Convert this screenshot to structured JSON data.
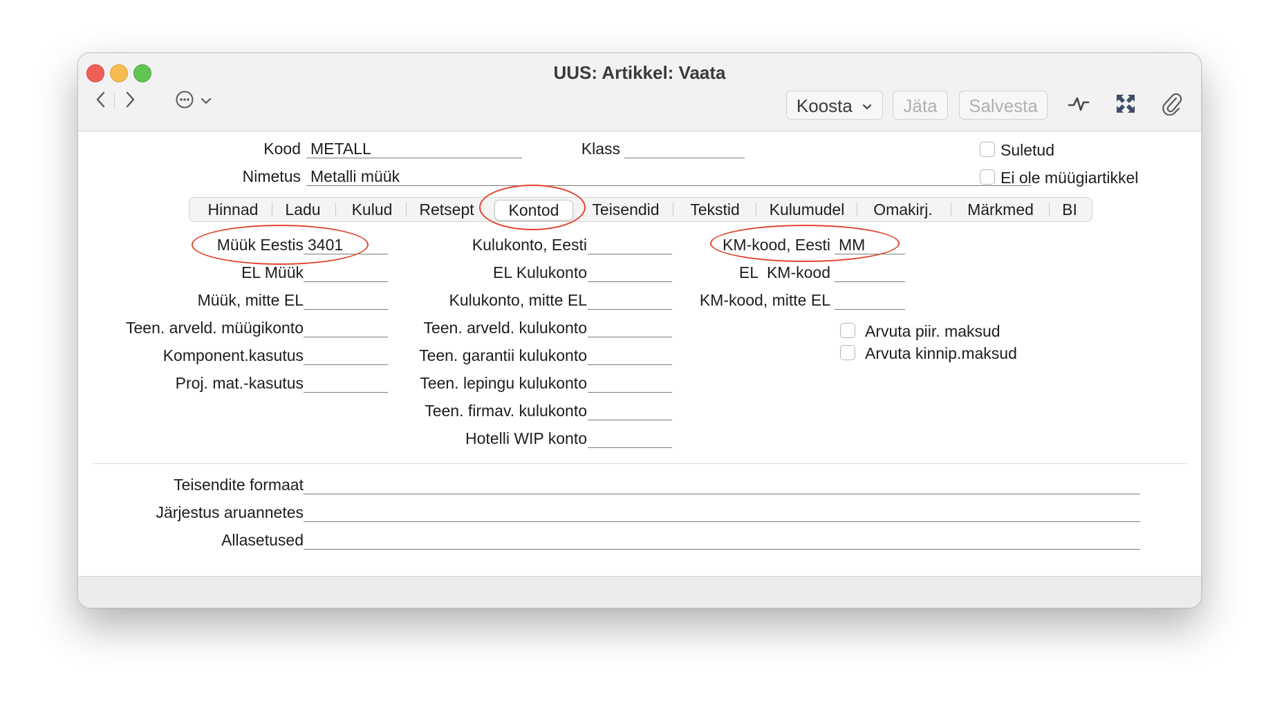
{
  "window": {
    "title": "UUS: Artikkel: Vaata",
    "colors": {
      "close": "#ee5f57",
      "minimize": "#f5bd4f",
      "zoom": "#61c454",
      "annotation": "#e0442c"
    }
  },
  "toolbar": {
    "koosta_label": "Koosta",
    "jata_label": "Jäta",
    "salvesta_label": "Salvesta",
    "icons": [
      "back-icon",
      "forward-icon",
      "more-icon",
      "chevron-down-icon",
      "activity-icon",
      "fullscreen-icon",
      "paperclip-icon"
    ]
  },
  "header": {
    "kood_label": "Kood",
    "kood_value": "METALL",
    "klass_label": "Klass",
    "klass_value": "",
    "nimetus_label": "Nimetus",
    "nimetus_value": "Metalli müük",
    "suletud_label": "Suletud",
    "ei_ole_label": "Ei ole müügiartikkel"
  },
  "tabs": [
    "Hinnad",
    "Ladu",
    "Kulud",
    "Retsept",
    "Kontod",
    "Teisendid",
    "Tekstid",
    "Kulumudel",
    "Omakirj.",
    "Märkmed",
    "BI"
  ],
  "selected_tab": "Kontod",
  "accounts": {
    "col1": [
      {
        "label": "Müük Eestis",
        "value": "3401"
      },
      {
        "label": "EL Müük",
        "value": ""
      },
      {
        "label": "Müük, mitte EL",
        "value": ""
      },
      {
        "label": "Teen. arveld. müügikonto",
        "value": ""
      },
      {
        "label": "Komponent.kasutus",
        "value": ""
      },
      {
        "label": "Proj. mat.-kasutus",
        "value": ""
      }
    ],
    "col2": [
      {
        "label": "Kulukonto, Eesti",
        "value": ""
      },
      {
        "label": "EL Kulukonto",
        "value": ""
      },
      {
        "label": "Kulukonto, mitte EL",
        "value": ""
      },
      {
        "label": "Teen. arveld. kulukonto",
        "value": ""
      },
      {
        "label": "Teen. garantii kulukonto",
        "value": ""
      },
      {
        "label": "Teen. lepingu kulukonto",
        "value": ""
      },
      {
        "label": "Teen. firmav. kulukonto",
        "value": ""
      },
      {
        "label": "Hotelli WIP konto",
        "value": ""
      }
    ],
    "col3": [
      {
        "label": "KM-kood, Eesti",
        "value": "MM"
      },
      {
        "label": "EL  KM-kood",
        "value": ""
      },
      {
        "label": "KM-kood, mitte EL",
        "value": ""
      }
    ],
    "checkboxes": [
      "Arvuta piir. maksud",
      "Arvuta kinnip.maksud"
    ]
  },
  "bottom": {
    "teisendite_label": "Teisendite formaat",
    "jarjestus_label": "Järjestus aruannetes",
    "allasetused_label": "Allasetused"
  }
}
